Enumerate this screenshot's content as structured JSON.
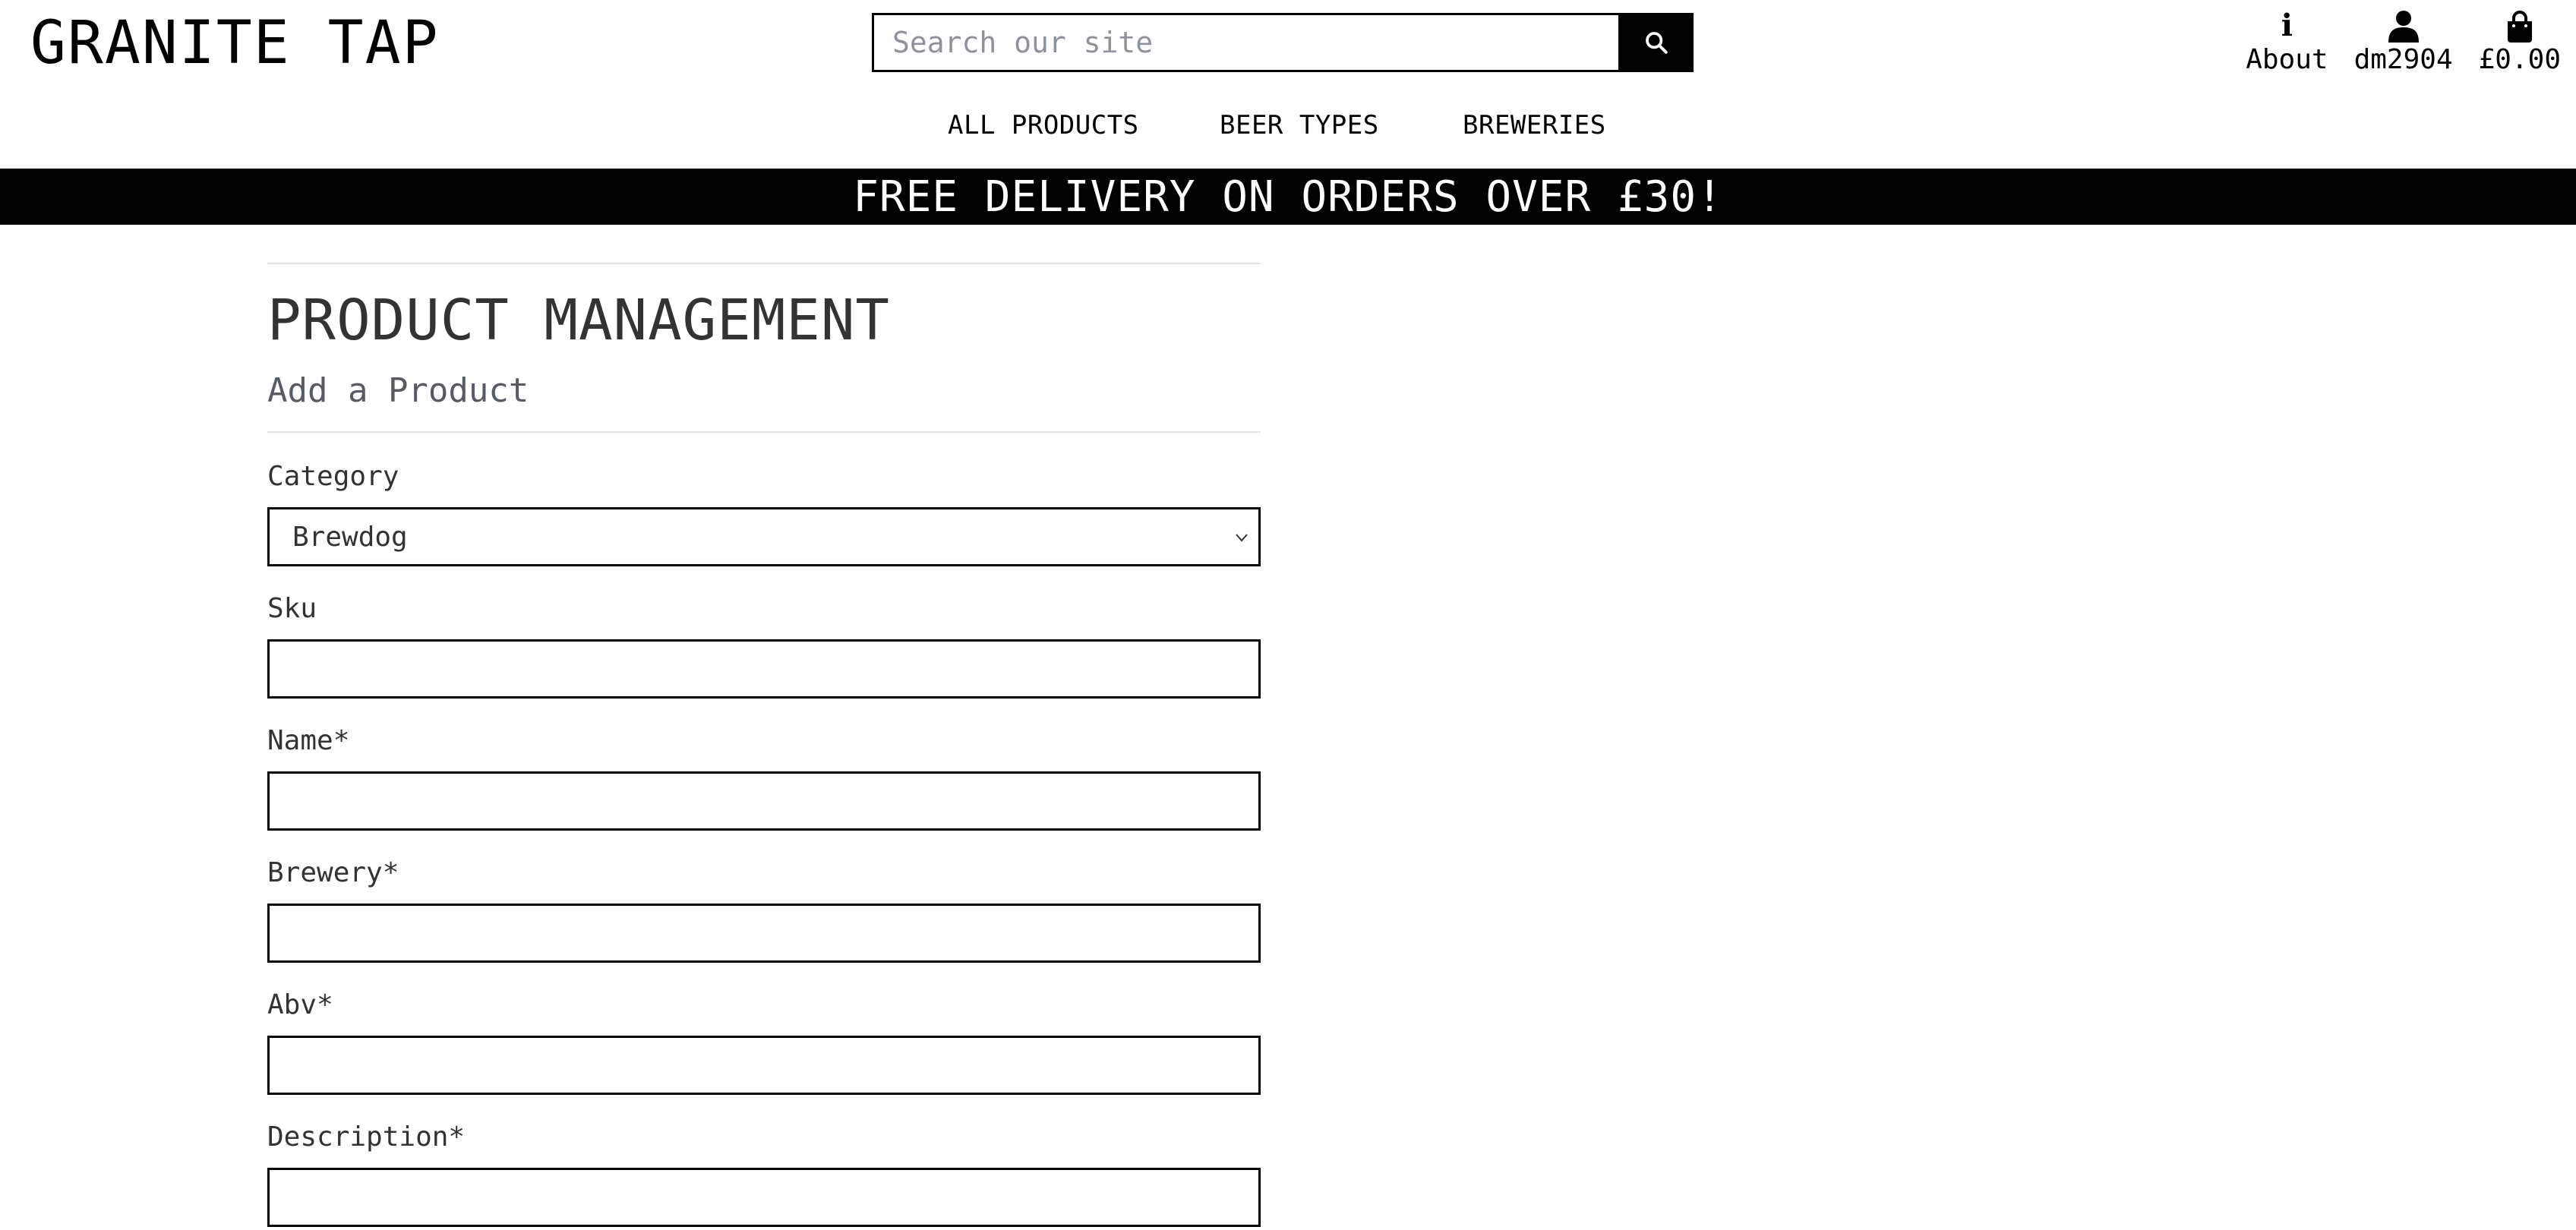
{
  "header": {
    "brand": "GRANITE TAP",
    "search_placeholder": "Search our site",
    "links": {
      "about": "About",
      "account": "dm2904",
      "bag": "£0.00"
    },
    "icons": {
      "search": "search-icon",
      "about": "info-icon",
      "account": "user-icon",
      "bag": "shopping-bag-icon"
    }
  },
  "nav": {
    "all_products": "ALL PRODUCTS",
    "beer_types": "BEER TYPES",
    "breweries": "BREWERIES"
  },
  "banner": {
    "text": "FREE DELIVERY ON ORDERS OVER £30!"
  },
  "page": {
    "title": "PRODUCT MANAGEMENT",
    "subtitle": "Add a Product"
  },
  "form": {
    "category": {
      "label": "Category",
      "value": "Brewdog"
    },
    "sku": {
      "label": "Sku",
      "value": ""
    },
    "name": {
      "label": "Name*",
      "value": ""
    },
    "brewery": {
      "label": "Brewery*",
      "value": ""
    },
    "abv": {
      "label": "Abv*",
      "value": ""
    },
    "description": {
      "label": "Description*",
      "value": ""
    }
  },
  "colors": {
    "banner_bg": "#000000",
    "banner_text": "#ffffff",
    "text": "#333333",
    "rule": "#e3e3e3"
  }
}
